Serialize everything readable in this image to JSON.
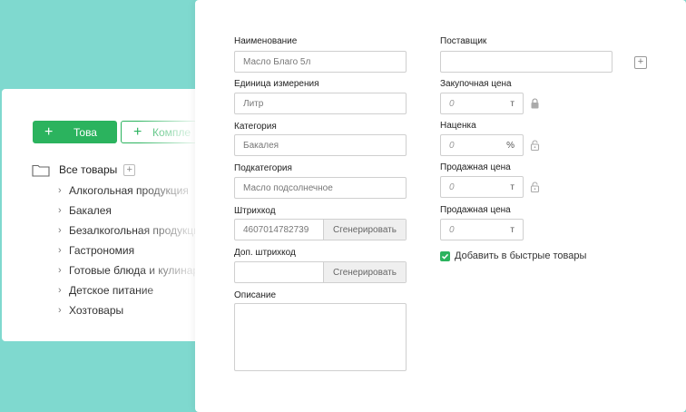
{
  "catalog": {
    "add_product_label": "Това",
    "add_kit_label": "Компле",
    "root_label": "Все товары",
    "categories": [
      "Алкогольная продукция",
      "Бакалея",
      "Безалкогольная продукция",
      "Гастрономия",
      "Готовые блюда и кулинария",
      "Детское питание",
      "Хозтовары"
    ]
  },
  "form": {
    "name": {
      "label": "Наименование",
      "value": "Масло Благо 5л"
    },
    "unit": {
      "label": "Единица измерения",
      "value": "Литр"
    },
    "category": {
      "label": "Категория",
      "value": "Бакалея"
    },
    "subcategory": {
      "label": "Подкатегория",
      "value": "Масло подсолнечное"
    },
    "barcode": {
      "label": "Штрихкод",
      "value": "4607014782739",
      "generate": "Сгенерировать"
    },
    "extra_barcode": {
      "label": "Доп. штрихкод",
      "value": "",
      "generate": "Сгенерировать"
    },
    "description": {
      "label": "Описание",
      "value": ""
    },
    "supplier": {
      "label": "Поставщик",
      "value": ""
    },
    "purchase_price": {
      "label": "Закупочная цена",
      "value": "0",
      "unit": "т"
    },
    "markup": {
      "label": "Наценка",
      "value": "0",
      "unit": "%"
    },
    "sale_price": {
      "label": "Продажная цена",
      "value": "0",
      "unit": "т"
    },
    "sale_price2": {
      "label": "Продажная цена",
      "value": "0",
      "unit": "т"
    },
    "quick_products": {
      "label": "Добавить в быстрые товары",
      "checked": true
    }
  },
  "colors": {
    "accent": "#2bb35e",
    "background": "#7fd9cf"
  },
  "icons": [
    "plus-icon",
    "folder-icon",
    "chevron-right-icon",
    "lock-icon",
    "check-icon"
  ]
}
